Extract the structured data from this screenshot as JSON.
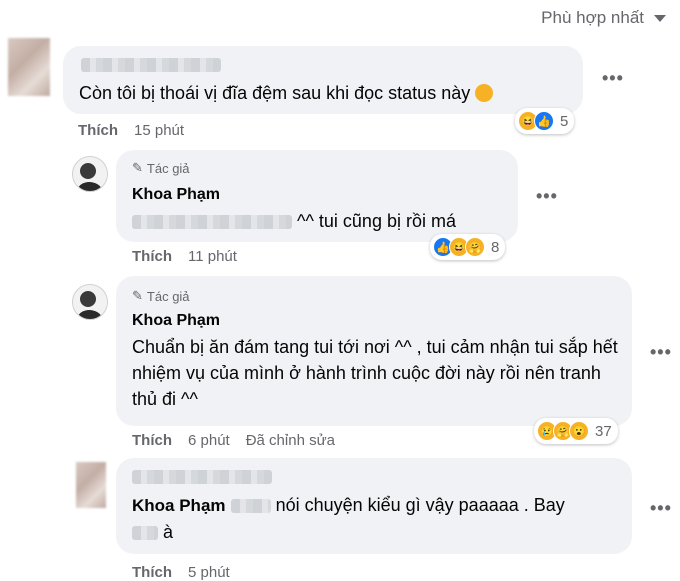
{
  "sort": {
    "label": "Phù hợp nhất"
  },
  "comments": [
    {
      "author_blurred": true,
      "text": "Còn tôi bị thoái vị đĩa đệm sau khi đọc status này",
      "like": "Thích",
      "time": "15 phút",
      "reaction_count": "5",
      "reactions": [
        "haha-icon",
        "like-icon"
      ]
    },
    {
      "author_tag": "Tác giả",
      "name": "Khoa Phạm",
      "text": "^^ tui cũng bị rồi má",
      "like": "Thích",
      "time": "11 phút",
      "reaction_count": "8",
      "reactions": [
        "like-icon",
        "haha-icon",
        "care-icon"
      ]
    },
    {
      "author_tag": "Tác giả",
      "name": "Khoa Phạm",
      "text": "Chuẩn bị ăn đám tang tui tới nơi ^^ , tui cảm nhận tui sắp hết nhiệm vụ của mình ở hành trình cuộc đời này rồi nên tranh thủ đi ^^",
      "like": "Thích",
      "time": "6 phút",
      "edited": "Đã chỉnh sửa",
      "reaction_count": "37",
      "reactions": [
        "sad-icon",
        "care-icon",
        "wow-icon"
      ]
    },
    {
      "name": "Khoa Phạm",
      "text": "nói chuyện kiểu gì vậy paaaaa . Bay",
      "text2": "à",
      "like": "Thích",
      "time": "5 phút"
    }
  ]
}
